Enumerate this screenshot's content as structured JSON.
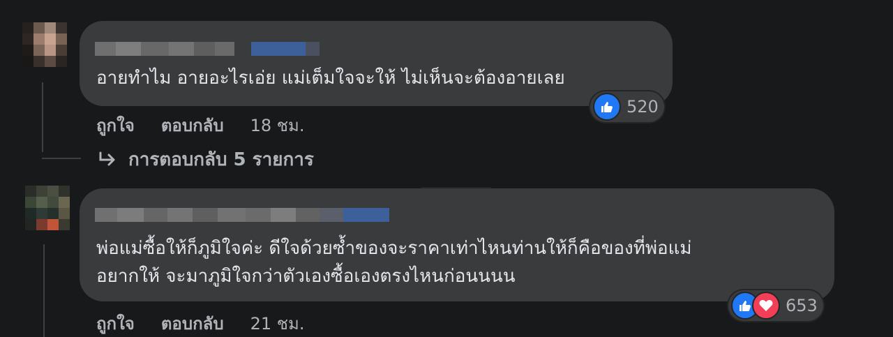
{
  "comments": [
    {
      "text_lines": [
        "อายทำไม อายอะไรเอ่ย แม่เต็มใจจะให้ ไม่เห็นจะต้องอายเลย"
      ],
      "actions": {
        "like": "ถูกใจ",
        "reply": "ตอบกลับ",
        "time": "18 ชม."
      },
      "reactions": {
        "icons": [
          "like-icon"
        ],
        "count": "520"
      },
      "replies_label": "การตอบกลับ 5 รายการ"
    },
    {
      "text_lines": [
        "พ่อแม่ซื้อให้ก็ภูมิใจค่ะ ดีใจด้วยซ้ำของจะราคาเท่าไหนท่านให้ก็คือของที่พ่อแม่",
        "อยากให้ จะมาภูมิใจกว่าตัวเองซื้อเองตรงไหนก่อนนนน"
      ],
      "actions": {
        "like": "ถูกใจ",
        "reply": "ตอบกลับ",
        "time": "21 ชม."
      },
      "reactions": {
        "icons": [
          "like-icon",
          "love-icon"
        ],
        "count": "653"
      }
    }
  ],
  "colors": {
    "background": "#18191a",
    "bubble": "#3a3b3c",
    "text": "#e4e6eb",
    "secondary_text": "#b0b3b8",
    "like_blue": "#2078f4",
    "love_red": "#f33e58"
  }
}
